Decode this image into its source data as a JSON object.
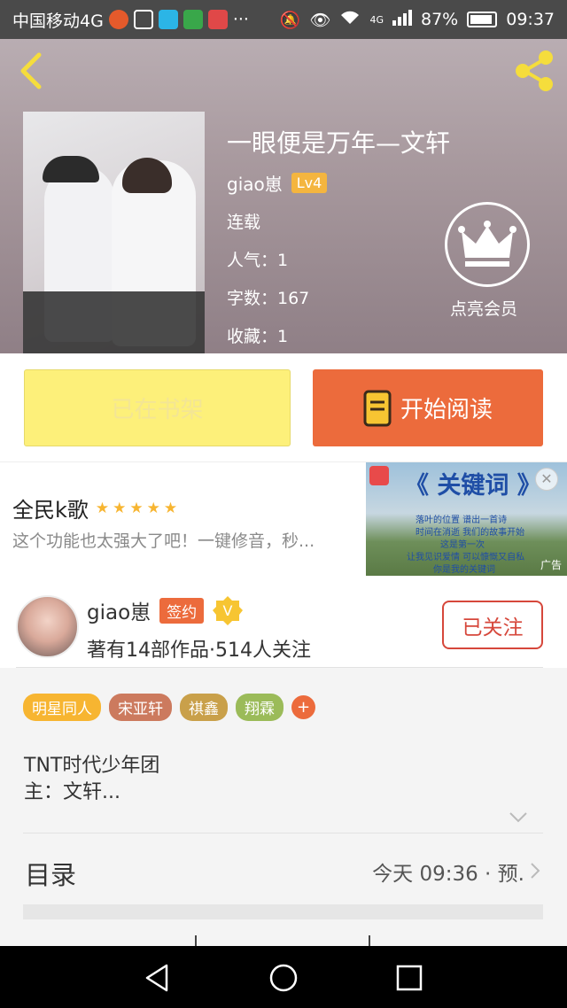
{
  "status_bar": {
    "carrier": "中国移动4G",
    "battery": "87%",
    "time": "09:37",
    "network": "4G"
  },
  "header": {
    "book_title": "一眼便是万年—文轩",
    "author": "giao崽",
    "level": "Lv4",
    "status": "连载",
    "popularity": "人气：1",
    "word_count": "字数：167",
    "favorites": "收藏：1",
    "vip_label": "点亮会员"
  },
  "actions": {
    "shelf_label": "已在书架",
    "read_label": "开始阅读"
  },
  "ad": {
    "title": "全民k歌",
    "description": "这个功能也太强大了吧！一键修音，秒...",
    "image_keyword": "《 关键词 》",
    "image_lines": [
      "落叶的位置 谱出一首诗",
      "时间在消逝 我们的故事开始",
      "这是第一次",
      "让我见识爱情 可以慷慨又自私",
      "你是我的关键词"
    ],
    "ad_tag": "广告"
  },
  "author_card": {
    "name": "giao崽",
    "sign_badge": "签约",
    "stats": "著有14部作品·514人关注",
    "follow_label": "已关注"
  },
  "tags": [
    {
      "label": "明星同人",
      "color": "#f7b531"
    },
    {
      "label": "宋亚轩",
      "color": "#cc7a5e"
    },
    {
      "label": "祺鑫",
      "color": "#c9a04a"
    },
    {
      "label": "翔霖",
      "color": "#9bbb59"
    }
  ],
  "tag_add": "+",
  "description": {
    "line1": "TNT时代少年团",
    "line2": "主：文轩..."
  },
  "toc": {
    "title": "目录",
    "latest": "今天 09:36 · 预."
  },
  "colors": {
    "accent": "#ec6b3c",
    "shelf_yellow": "#fdf07a",
    "follow_red": "#d6473b"
  }
}
